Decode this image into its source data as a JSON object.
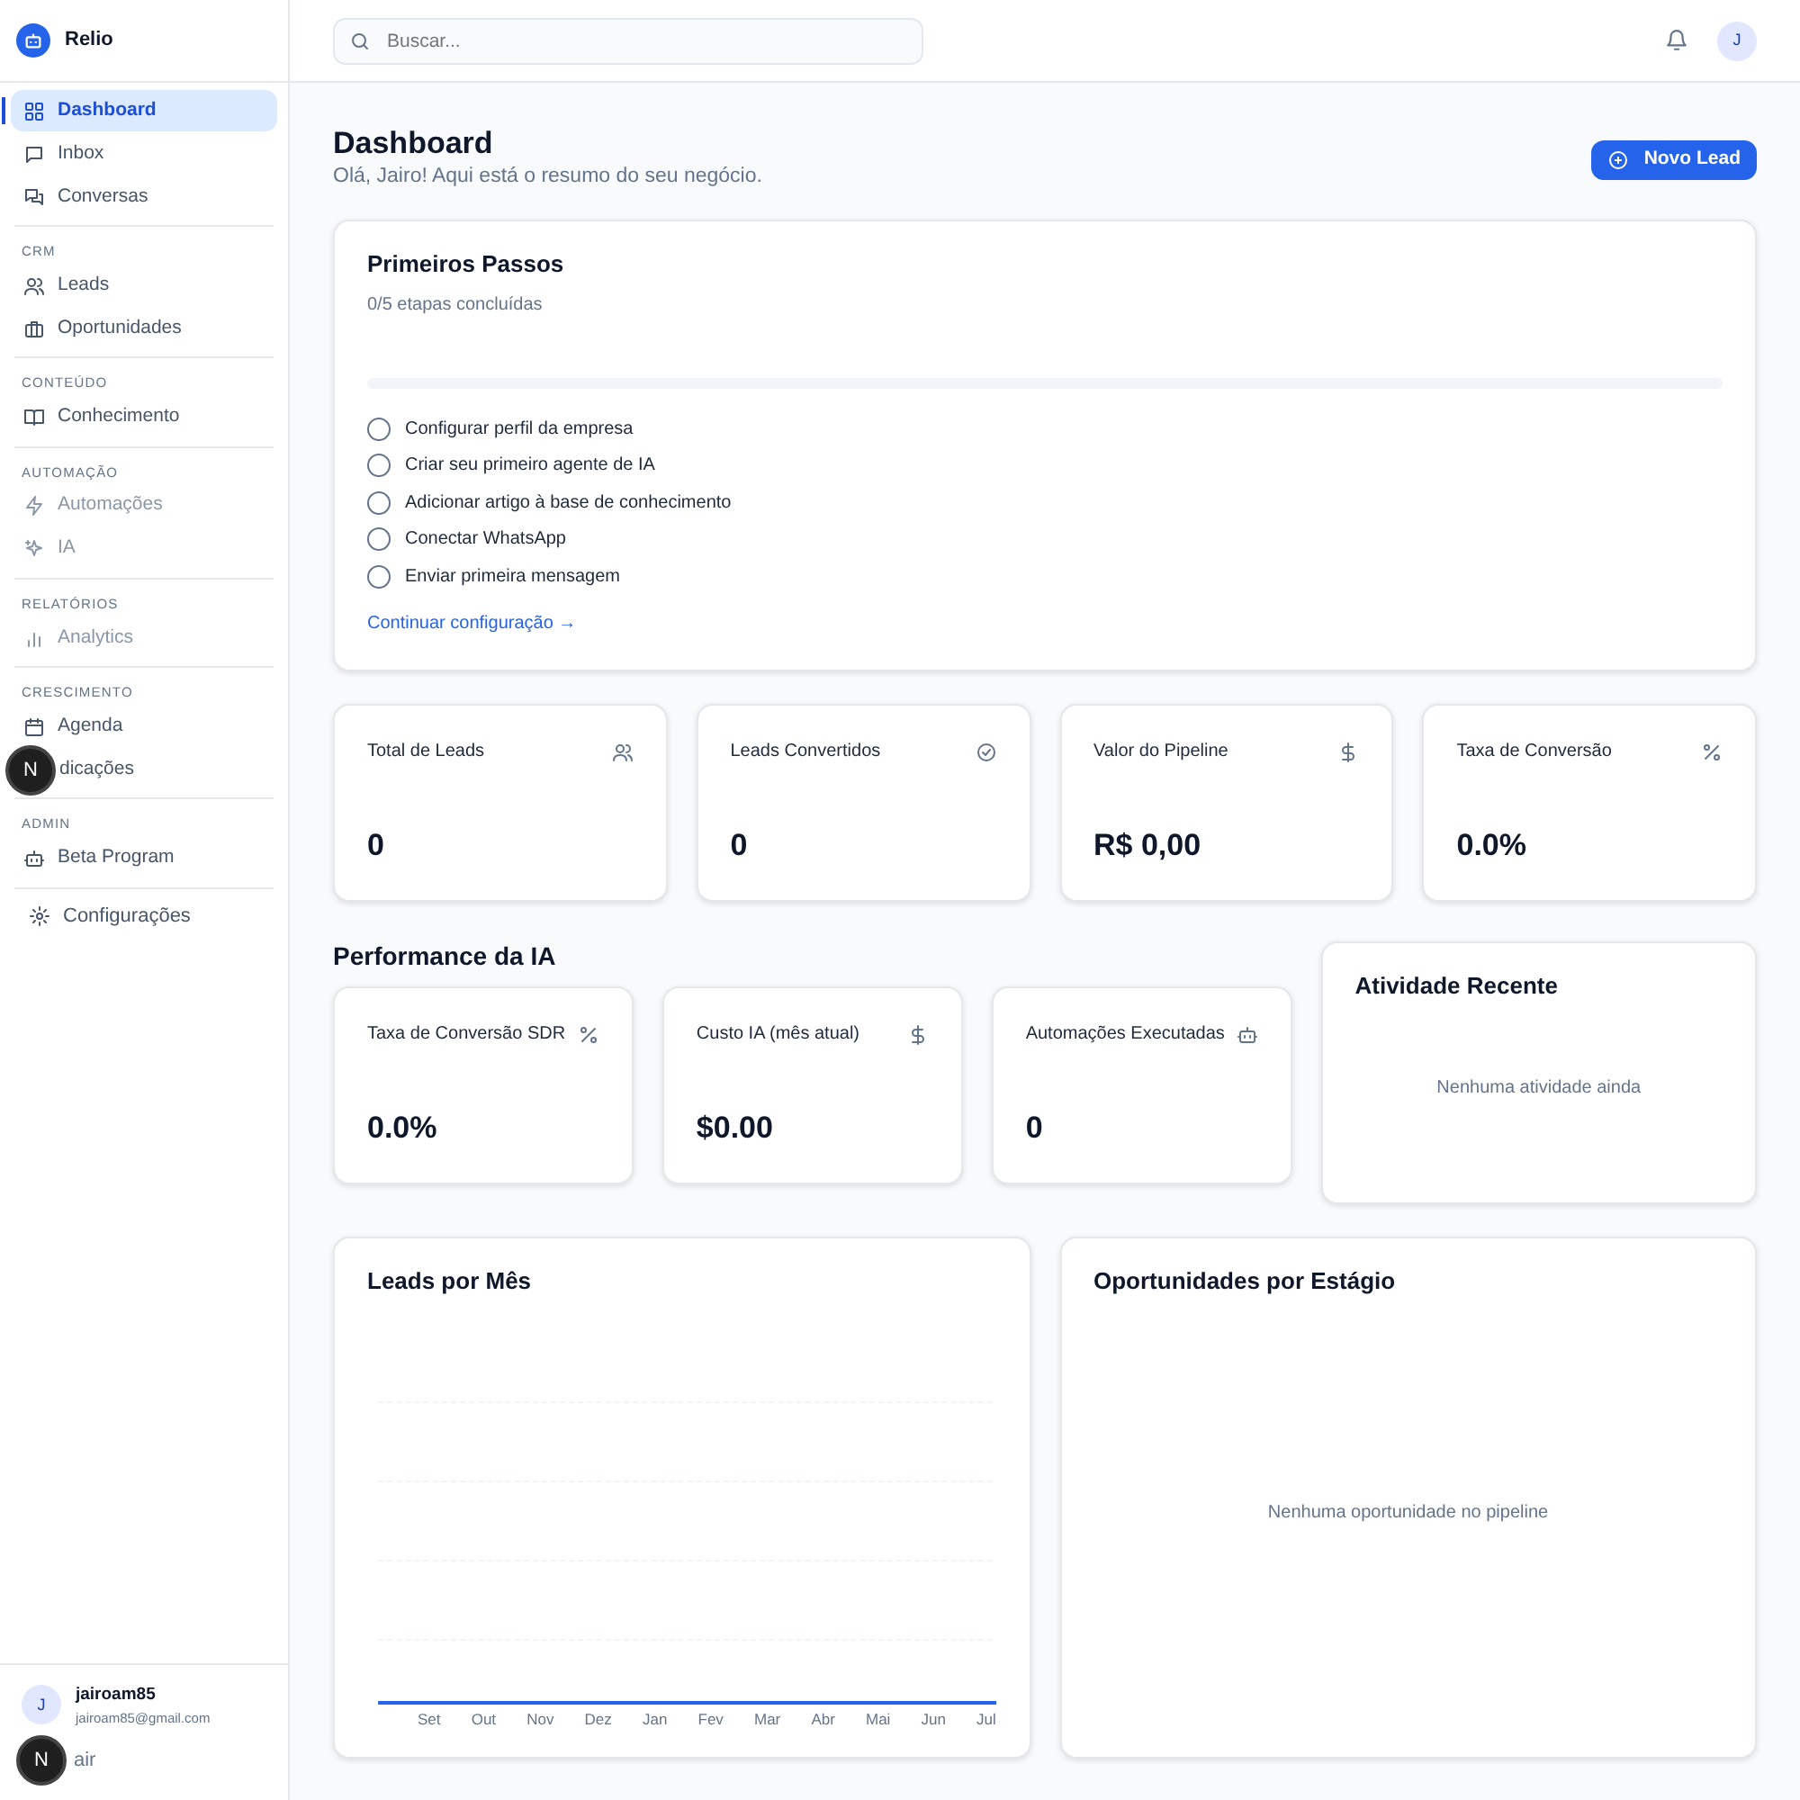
{
  "brand": {
    "name": "Relio"
  },
  "sidebar": {
    "groups": [
      {
        "items": [
          {
            "label": "Dashboard",
            "selected": true,
            "disabled": false
          },
          {
            "label": "Inbox",
            "selected": false,
            "disabled": false
          },
          {
            "label": "Conversas",
            "selected": false,
            "disabled": false
          }
        ]
      },
      {
        "heading": "CRM",
        "items": [
          {
            "label": "Leads",
            "selected": false,
            "disabled": false
          },
          {
            "label": "Oportunidades",
            "selected": false,
            "disabled": false
          }
        ]
      },
      {
        "heading": "CONTEÚDO",
        "items": [
          {
            "label": "Conhecimento",
            "selected": false,
            "disabled": false
          }
        ]
      },
      {
        "heading": "AUTOMAÇÃO",
        "items": [
          {
            "label": "Automações",
            "selected": false,
            "disabled": true
          },
          {
            "label": "IA",
            "selected": false,
            "disabled": true
          }
        ]
      },
      {
        "heading": "RELATÓRIOS",
        "items": [
          {
            "label": "Analytics",
            "selected": false,
            "disabled": true
          }
        ]
      },
      {
        "heading": "CRESCIMENTO",
        "items": [
          {
            "label": "Agenda",
            "selected": false,
            "disabled": false
          },
          {
            "label": "dicações",
            "selected": false,
            "disabled": false,
            "badge": "N"
          }
        ]
      },
      {
        "heading": "ADMIN",
        "items": [
          {
            "label": "Beta Program",
            "selected": false,
            "disabled": false
          }
        ]
      },
      {
        "items": [
          {
            "label": "Configurações",
            "selected": false,
            "disabled": false
          }
        ]
      }
    ],
    "user": {
      "initial": "J",
      "name": "jairoam85",
      "email": "jairoam85@gmail.com"
    },
    "logout": {
      "label": "air",
      "badge": "N"
    }
  },
  "topbar": {
    "search_placeholder": "Buscar...",
    "avatar": "J"
  },
  "header": {
    "title": "Dashboard",
    "subtitle": "Olá, Jairo! Aqui está o resumo do seu negócio.",
    "button": "Novo Lead"
  },
  "onboarding": {
    "title": "Primeiros Passos",
    "progress_text": "0/5 etapas concluídas",
    "level": 0,
    "steps": [
      {
        "label": "Configurar perfil da empresa",
        "checked": false
      },
      {
        "label": "Criar seu primeiro agente de IA",
        "checked": false
      },
      {
        "label": "Adicionar artigo à base de conhecimento",
        "checked": false
      },
      {
        "label": "Conectar WhatsApp",
        "checked": false
      },
      {
        "label": "Enviar primeira mensagem",
        "checked": false
      }
    ],
    "link": "Continuar configuração →"
  },
  "stats": [
    {
      "label": "Total de Leads",
      "value": "0"
    },
    {
      "label": "Leads Convertidos",
      "value": "0"
    },
    {
      "label": "Valor do Pipeline",
      "value": "R$ 0,00"
    },
    {
      "label": "Taxa de Conversão",
      "value": "0.0%"
    }
  ],
  "ai_performance": {
    "title": "Performance da IA",
    "cards": [
      {
        "label": "Taxa de Conversão SDR",
        "value": "0.0%"
      },
      {
        "label": "Custo IA (mês atual)",
        "value": "$0.00"
      },
      {
        "label": "Automações Executadas",
        "value": "0"
      }
    ]
  },
  "recent_activity": {
    "title": "Atividade Recente",
    "empty": "Nenhuma atividade ainda"
  },
  "leads_chart": {
    "title": "Leads por Mês",
    "x_labels": [
      "Set",
      "Out",
      "Nov",
      "Dez",
      "Jan",
      "Fev",
      "Mar",
      "Abr",
      "Mai",
      "Jun",
      "Jul"
    ]
  },
  "stage_chart": {
    "title": "Oportunidades por Estágio",
    "empty": "Nenhuma oportunidade no pipeline"
  }
}
